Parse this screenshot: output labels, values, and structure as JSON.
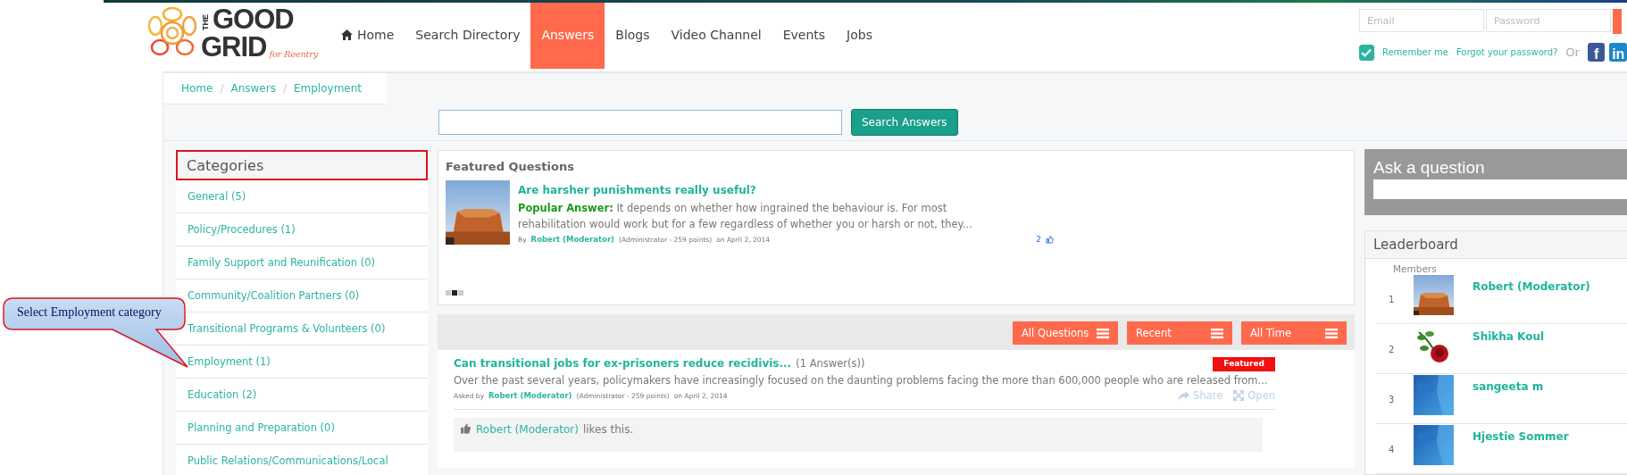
{
  "header": {
    "logo": {
      "small": "THE",
      "line_1": "GOOD",
      "line_2": "GRID",
      "tagline": "for Reentry"
    },
    "nav": [
      {
        "label": "Home",
        "kind": "home",
        "selected": false
      },
      {
        "label": "Search Directory",
        "kind": "link",
        "selected": false
      },
      {
        "label": "Answers",
        "kind": "link",
        "selected": true
      },
      {
        "label": "Blogs",
        "kind": "link",
        "selected": false
      },
      {
        "label": "Video Channel",
        "kind": "link",
        "selected": false
      },
      {
        "label": "Events",
        "kind": "link",
        "selected": false
      },
      {
        "label": "Jobs",
        "kind": "link",
        "selected": false
      }
    ],
    "login": {
      "email_placeholder": "Email",
      "password_placeholder": "Password",
      "remember": {
        "label": "Remember me",
        "checked": true
      },
      "forgot": "Forgot your password?",
      "or": "Or",
      "social": [
        {
          "label": "f"
        },
        {
          "label": "in"
        }
      ]
    }
  },
  "breadcrumb": {
    "items": [
      "Home",
      "Answers",
      "Employment"
    ],
    "separators": [
      "/",
      "/"
    ]
  },
  "search": {
    "button": "Search Answers"
  },
  "categories": {
    "title": "Categories",
    "highlighted": true,
    "items": [
      "General (5)",
      "Policy/Procedures (1)",
      "Family Support and Reunification (0)",
      "Community/Coalition Partners (0)",
      "Transitional Programs & Volunteers (0)",
      "Employment (1)",
      "Education (2)",
      "Planning and Preparation (0)",
      "Public Relations/Communications/Local"
    ]
  },
  "callout": {
    "text": "Select Employment category"
  },
  "featured": {
    "title": "Featured Questions",
    "items": [
      {
        "question": "Are harsher punishments really useful?",
        "answer_label": "Popular Answer:",
        "answer": "It depends on whether how ingrained the behaviour is. For most rehabilitation would work but for a few regardless of whether you or harsh or not, they...",
        "by": "By",
        "author": "Robert (Moderator)",
        "role": "(Administrator - 259 points)",
        "date": "on April 2, 2014",
        "likes": "2"
      }
    ],
    "pager": [
      {
        "selected": false
      },
      {
        "selected": true
      },
      {
        "selected": false
      }
    ]
  },
  "filters": [
    {
      "label": "All Questions"
    },
    {
      "label": "Recent"
    },
    {
      "label": "All Time"
    }
  ],
  "questions": [
    {
      "title": "Can transitional jobs for ex-prisoners reduce recidivis...",
      "answers": "(1 Answer(s))",
      "badge": "Featured",
      "excerpt": "Over the past several years, policymakers have increasingly focused on the daunting problems facing the more than 600,000 people who are released from...",
      "asked_by": "Asked by",
      "author": "Robert (Moderator)",
      "role": "(Administrator - 259 points)",
      "date": "on April 2, 2014",
      "actions": [
        "Share",
        "Open"
      ],
      "like_user": "Robert (Moderator)",
      "like_text": "likes this."
    }
  ],
  "ask": {
    "title": "Ask a question"
  },
  "leaderboard": {
    "title": "Leaderboard",
    "column": "Members",
    "members": [
      {
        "rank": "1",
        "name": "Robert (Moderator)"
      },
      {
        "rank": "2",
        "name": "Shikha Koul"
      },
      {
        "rank": "3",
        "name": "sangeeta m"
      },
      {
        "rank": "4",
        "name": "Hjestie Sommer"
      }
    ]
  }
}
